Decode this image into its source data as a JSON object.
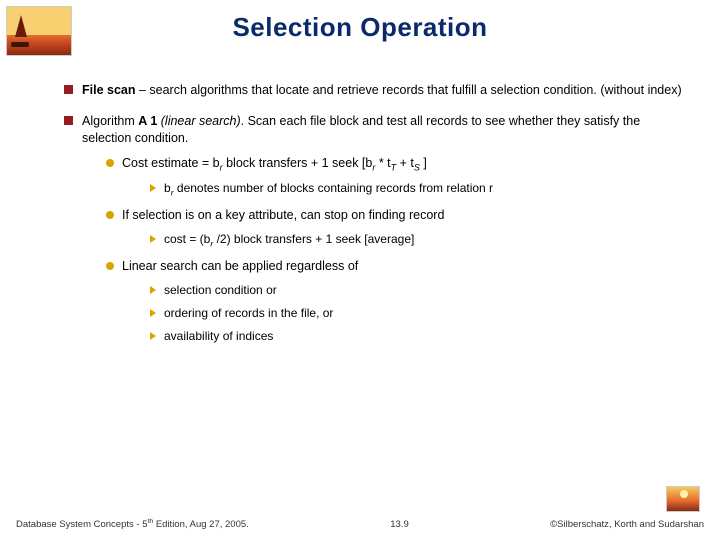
{
  "title": "Selection Operation",
  "bullets": {
    "b1_pre": "File scan",
    "b1_post": " – search algorithms that locate and retrieve records that fulfill a selection condition. (without index)",
    "b2_pre": "Algorithm ",
    "b2_mid": "A 1 ",
    "b2_paren": "(linear search)",
    "b2_post": ".  Scan each file block and test all records to see whether they satisfy the selection condition.",
    "c1_a": "Cost estimate = b",
    "c1_sub1": "r",
    "c1_b": " block transfers + 1 seek [b",
    "c1_sub2": "r",
    "c1_c": " * t",
    "c1_sub3": "T",
    "c1_d": " + t",
    "c1_sub4": "S",
    "c1_e": " ]",
    "d1_a": "b",
    "d1_sub": "r",
    "d1_b": "  denotes number of blocks containing records from relation r",
    "c2": "If selection is on a key attribute, can stop on finding record",
    "d2_a": "cost = (b",
    "d2_sub": "r",
    "d2_b": " /2) block transfers + 1 seek [average]",
    "c3": "Linear search can be applied regardless of",
    "d3": "selection condition or",
    "d4": "ordering of records in the file, or",
    "d5": "availability of indices"
  },
  "footer": {
    "left_a": "Database System Concepts - 5",
    "left_sup": "th",
    "left_b": " Edition, Aug 27, 2005.",
    "center": "13.9",
    "right": "©Silberschatz, Korth and Sudarshan"
  }
}
